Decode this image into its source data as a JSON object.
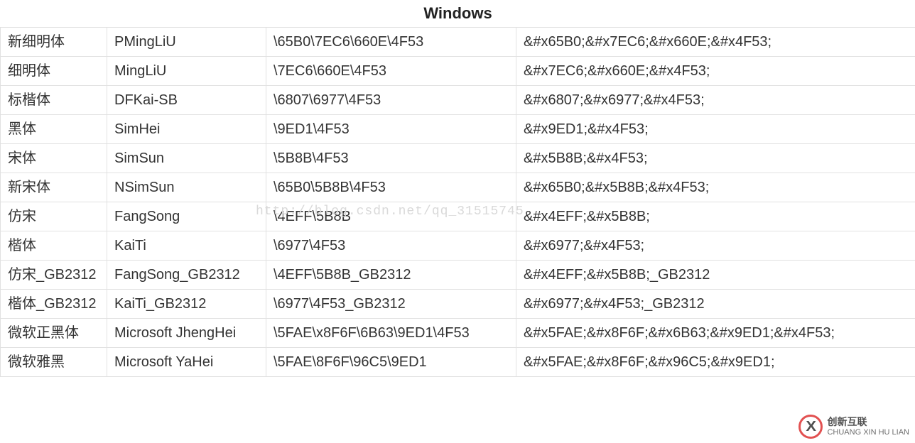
{
  "title": "Windows",
  "watermark": "http://blog.csdn.net/qq_31515745",
  "logo": {
    "cn": "创新互联",
    "en": "CHUANG XIN HU LIAN"
  },
  "rows": [
    {
      "c0": "新细明体",
      "c1": "PMingLiU",
      "c2": "\\65B0\\7EC6\\660E\\4F53",
      "c3": "&#x65B0;&#x7EC6;&#x660E;&#x4F53;"
    },
    {
      "c0": "细明体",
      "c1": "MingLiU",
      "c2": "\\7EC6\\660E\\4F53",
      "c3": "&#x7EC6;&#x660E;&#x4F53;"
    },
    {
      "c0": "标楷体",
      "c1": "DFKai-SB",
      "c2": "\\6807\\6977\\4F53",
      "c3": "&#x6807;&#x6977;&#x4F53;"
    },
    {
      "c0": "黑体",
      "c1": "SimHei",
      "c2": "\\9ED1\\4F53",
      "c3": "&#x9ED1;&#x4F53;"
    },
    {
      "c0": "宋体",
      "c1": "SimSun",
      "c2": "\\5B8B\\4F53",
      "c3": "&#x5B8B;&#x4F53;"
    },
    {
      "c0": "新宋体",
      "c1": "NSimSun",
      "c2": "\\65B0\\5B8B\\4F53",
      "c3": "&#x65B0;&#x5B8B;&#x4F53;"
    },
    {
      "c0": "仿宋",
      "c1": "FangSong",
      "c2": "\\4EFF\\5B8B",
      "c3": "&#x4EFF;&#x5B8B;"
    },
    {
      "c0": "楷体",
      "c1": "KaiTi",
      "c2": "\\6977\\4F53",
      "c3": "&#x6977;&#x4F53;"
    },
    {
      "c0": "仿宋_GB2312",
      "c1": "FangSong_GB2312",
      "c2": "\\4EFF\\5B8B_GB2312",
      "c3": "&#x4EFF;&#x5B8B;_GB2312"
    },
    {
      "c0": "楷体_GB2312",
      "c1": "KaiTi_GB2312",
      "c2": "\\6977\\4F53_GB2312",
      "c3": "&#x6977;&#x4F53;_GB2312"
    },
    {
      "c0": "微软正黑体",
      "c1": "Microsoft JhengHei",
      "c2": "\\5FAE\\x8F6F\\6B63\\9ED1\\4F53",
      "c3": "&#x5FAE;&#x8F6F;&#x6B63;&#x9ED1;&#x4F53;"
    },
    {
      "c0": "微软雅黑",
      "c1": "Microsoft YaHei",
      "c2": "\\5FAE\\8F6F\\96C5\\9ED1",
      "c3": "&#x5FAE;&#x8F6F;&#x96C5;&#x9ED1;"
    }
  ]
}
